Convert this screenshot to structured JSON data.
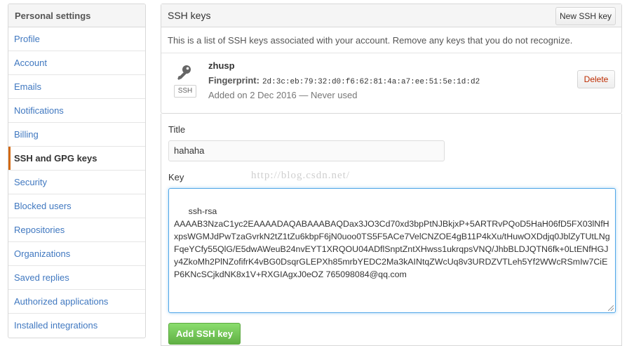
{
  "sidebar": {
    "header": "Personal settings",
    "items": [
      {
        "label": "Profile"
      },
      {
        "label": "Account"
      },
      {
        "label": "Emails"
      },
      {
        "label": "Notifications"
      },
      {
        "label": "Billing"
      },
      {
        "label": "SSH and GPG keys",
        "selected": true
      },
      {
        "label": "Security"
      },
      {
        "label": "Blocked users"
      },
      {
        "label": "Repositories"
      },
      {
        "label": "Organizations"
      },
      {
        "label": "Saved replies"
      },
      {
        "label": "Authorized applications"
      },
      {
        "label": "Installed integrations"
      }
    ]
  },
  "ssh_keys": {
    "title": "SSH keys",
    "new_key_button": "New SSH key",
    "description": "This is a list of SSH keys associated with your account. Remove any keys that you do not recognize.",
    "keys": [
      {
        "icon": "key-icon",
        "type_badge": "SSH",
        "name": "zhusp",
        "fingerprint_label": "Fingerprint:",
        "fingerprint": "2d:3c:eb:79:32:d0:f6:62:81:4a:a7:ee:51:5e:1d:d2",
        "added": "Added on 2 Dec 2016 — Never used",
        "delete_button": "Delete"
      }
    ]
  },
  "form": {
    "title_label": "Title",
    "title_value": "hahaha",
    "key_label": "Key",
    "key_value": "ssh-rsa\nAAAAB3NzaC1yc2EAAAADAQABAAABAQDax3JO3Cd70xd3bpPtNJBkjxP+5ARTRvPQoD5HaH06fD5FX03lNfHxpsWGMJdPwTzaGvrkN2tZ1tZu6kbpF6jN0uoo0TS5F5ACe7VelCNZOE4gB11P4kXu/tHuwOXDdjq0JblZyTUtLNgFqeYCfy55QlG/E5dwAWeuB24nvEYT1XRQOU04ADflSnptZntXHwss1ukrqpsVNQ/JhbBLDJQTN6fk+0LtENfHGJy4ZkoMh2PlNZofifrK4vBG0DsqrGLEPXh85mrbYEDC2Ma3kAINtqZWcUq8v3URDZVTLeh5Yf2WWcRSmIw7CiEP6KNcSCjkdNK8x1V+RXGIAgxJ0eOZ 765098084@qq.com",
    "add_button": "Add SSH key"
  },
  "watermark": "http://blog.csdn.net/",
  "colors": {
    "link": "#4078c0",
    "selected_marker": "#d26911",
    "delete": "#bd2c00",
    "add_button": "#60b044"
  }
}
